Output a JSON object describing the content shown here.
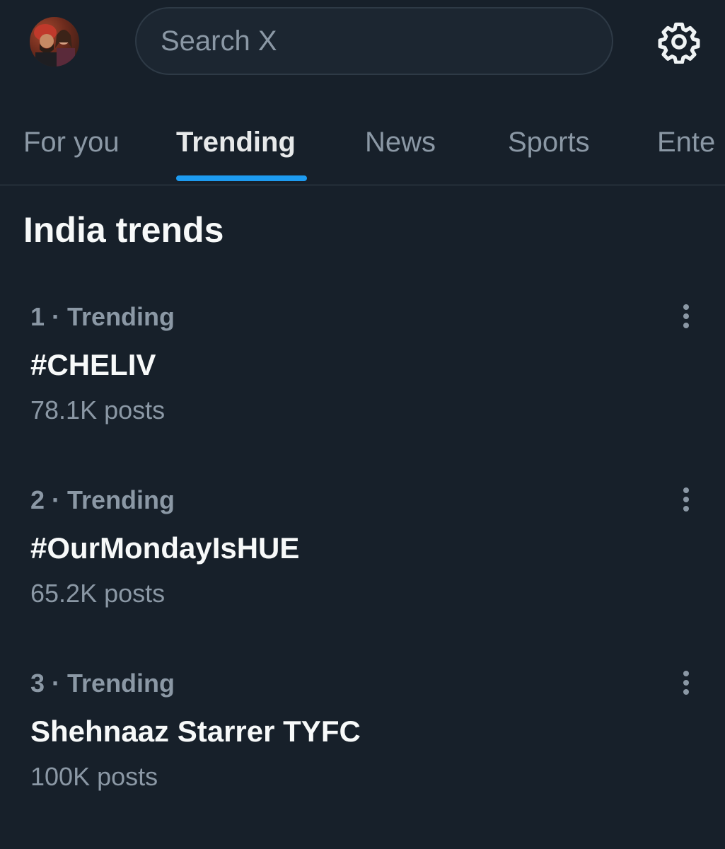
{
  "header": {
    "search_placeholder": "Search X",
    "settings_icon": "gear-icon",
    "avatar_icon": "profile-avatar"
  },
  "tabs": [
    {
      "label": "For you",
      "active": false
    },
    {
      "label": "Trending",
      "active": true
    },
    {
      "label": "News",
      "active": false
    },
    {
      "label": "Sports",
      "active": false
    },
    {
      "label": "Ente",
      "active": false
    }
  ],
  "section": {
    "title": "India trends"
  },
  "trends": [
    {
      "rank": "1",
      "category": "Trending",
      "name": "#CHELIV",
      "posts": "78.1K posts"
    },
    {
      "rank": "2",
      "category": "Trending",
      "name": "#OurMondayIsHUE",
      "posts": "65.2K posts"
    },
    {
      "rank": "3",
      "category": "Trending",
      "name": "Shehnaaz Starrer TYFC",
      "posts": "100K posts"
    }
  ],
  "colors": {
    "background": "#17202a",
    "accent": "#1d9bf0",
    "muted_text": "#8b98a5",
    "primary_text": "#f7f9f9"
  }
}
